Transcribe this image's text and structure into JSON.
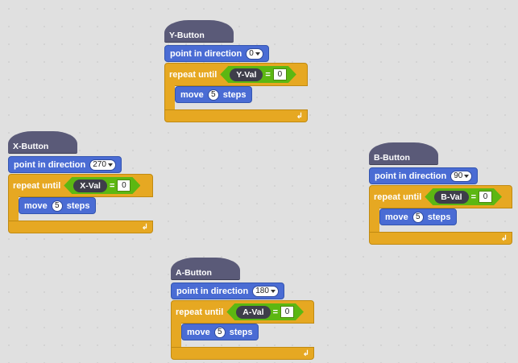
{
  "scripts": [
    {
      "hat": "Y-Button",
      "direction": "0",
      "variable": "Y-Val",
      "equals": "=",
      "compare": "0",
      "move_steps": "5"
    },
    {
      "hat": "X-Button",
      "direction": "270",
      "variable": "X-Val",
      "equals": "=",
      "compare": "0",
      "move_steps": "5"
    },
    {
      "hat": "B-Button",
      "direction": "90",
      "variable": "B-Val",
      "equals": "=",
      "compare": "0",
      "move_steps": "5"
    },
    {
      "hat": "A-Button",
      "direction": "180",
      "variable": "A-Val",
      "equals": "=",
      "compare": "0",
      "move_steps": "5"
    }
  ],
  "labels": {
    "point_in_direction": "point in direction",
    "repeat_until": "repeat until",
    "move": "move",
    "steps": "steps",
    "loop_arrow": "↲"
  },
  "colors": {
    "hat": "#5a5a78",
    "motion": "#4a6cd4",
    "control": "#e6a822",
    "operator": "#5cb712",
    "variable": "#3e3e4a"
  }
}
